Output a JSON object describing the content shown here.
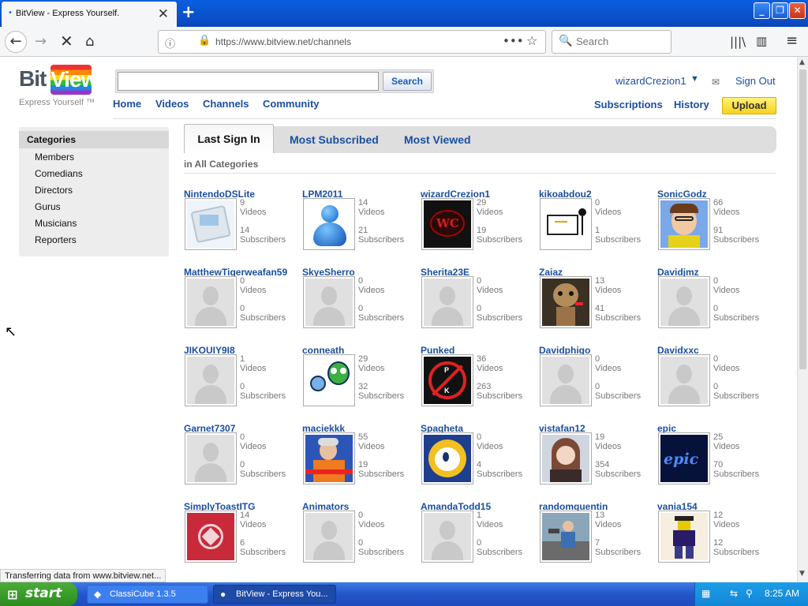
{
  "browser": {
    "tab_title": "BitView - Express Yourself.",
    "url": "https://www.bitview.net/channels",
    "search_placeholder": "Search"
  },
  "site": {
    "logo_bit": "Bit",
    "logo_view": "View",
    "tagline": "Express Yourself ™",
    "search_button": "Search",
    "nav": [
      "Home",
      "Videos",
      "Channels",
      "Community"
    ],
    "username": "wizardCrezion1",
    "sign_out": "Sign Out",
    "subscriptions": "Subscriptions",
    "history": "History",
    "upload": "Upload"
  },
  "categories": {
    "title": "Categories",
    "items": [
      "Members",
      "Comedians",
      "Directors",
      "Gurus",
      "Musicians",
      "Reporters"
    ]
  },
  "tabs": {
    "active": "Last Sign In",
    "others": [
      "Most Subscribed",
      "Most Viewed"
    ]
  },
  "in_categories": "in All Categories",
  "videos_label": "Videos",
  "subscribers_label": "Subscribers",
  "channels": [
    {
      "name": "NintendoDSLite",
      "videos": "9",
      "subscribers": "14",
      "thumb": "ds"
    },
    {
      "name": "LPM2011",
      "videos": "14",
      "subscribers": "21",
      "thumb": "msn"
    },
    {
      "name": "wizardCrezion1",
      "videos": "29",
      "subscribers": "19",
      "thumb": "wc"
    },
    {
      "name": "kikoabdou2",
      "videos": "0",
      "subscribers": "1",
      "thumb": "drawing"
    },
    {
      "name": "SonicGodz",
      "videos": "66",
      "subscribers": "91",
      "thumb": "cartoon"
    },
    {
      "name": "MatthewTigerweafan59",
      "videos": "0",
      "subscribers": "0",
      "thumb": "default"
    },
    {
      "name": "SkyeSherro",
      "videos": "0",
      "subscribers": "0",
      "thumb": "default"
    },
    {
      "name": "Sherita23E",
      "videos": "0",
      "subscribers": "0",
      "thumb": "default"
    },
    {
      "name": "Zaiaz",
      "videos": "13",
      "subscribers": "41",
      "thumb": "sackboy"
    },
    {
      "name": "Davidjmz",
      "videos": "0",
      "subscribers": "0",
      "thumb": "default"
    },
    {
      "name": "JIKOUIY9I8",
      "videos": "1",
      "subscribers": "0",
      "thumb": "default"
    },
    {
      "name": "conneath",
      "videos": "29",
      "subscribers": "32",
      "thumb": "blobs"
    },
    {
      "name": "Punked",
      "videos": "36",
      "subscribers": "263",
      "thumb": "punked"
    },
    {
      "name": "Davidphigo",
      "videos": "0",
      "subscribers": "0",
      "thumb": "default"
    },
    {
      "name": "Davidxxc",
      "videos": "0",
      "subscribers": "0",
      "thumb": "default"
    },
    {
      "name": "Garnet7307",
      "videos": "0",
      "subscribers": "0",
      "thumb": "default"
    },
    {
      "name": "maciekkk",
      "videos": "55",
      "subscribers": "19",
      "thumb": "photo"
    },
    {
      "name": "Spagheta",
      "videos": "0",
      "subscribers": "4",
      "thumb": "yellow"
    },
    {
      "name": "vistafan12",
      "videos": "19",
      "subscribers": "354",
      "thumb": "anime"
    },
    {
      "name": "epic",
      "videos": "25",
      "subscribers": "70",
      "thumb": "epic"
    },
    {
      "name": "SimplyToastITG",
      "videos": "14",
      "subscribers": "6",
      "thumb": "red"
    },
    {
      "name": "Animators",
      "videos": "0",
      "subscribers": "0",
      "thumb": "default"
    },
    {
      "name": "AmandaTodd15",
      "videos": "1",
      "subscribers": "0",
      "thumb": "default"
    },
    {
      "name": "randomquentin",
      "videos": "13",
      "subscribers": "7",
      "thumb": "meme"
    },
    {
      "name": "vania154",
      "videos": "12",
      "subscribers": "12",
      "thumb": "roblox"
    }
  ],
  "epic_text": "epic",
  "status_text": "Transferring data from www.bitview.net...",
  "taskbar": {
    "start": "start",
    "tasks": [
      "ClassiCube 1.3.5",
      "BitView - Express You..."
    ],
    "clock": "8:25 AM"
  }
}
